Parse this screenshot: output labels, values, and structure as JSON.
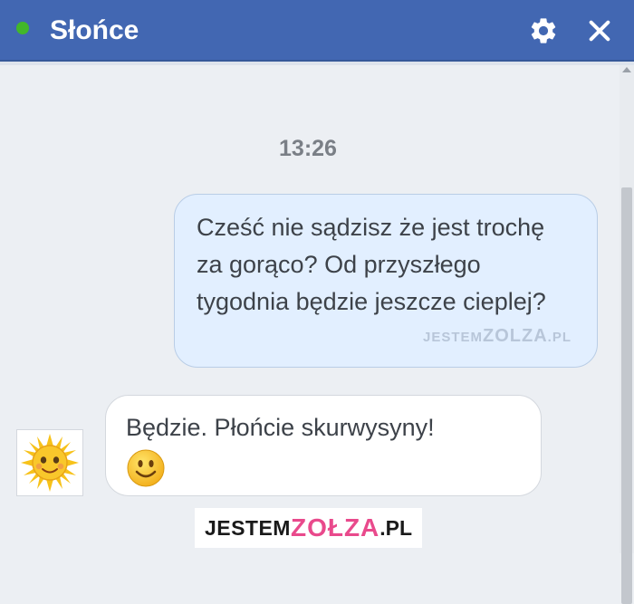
{
  "header": {
    "title": "Słońce",
    "status": "online",
    "icons": [
      "gear-icon",
      "close-icon"
    ],
    "color": "#4267b2"
  },
  "conversation": {
    "timestamp": "13:26",
    "messages": [
      {
        "direction": "outgoing",
        "text": "Cześć nie sądzisz że jest trochę za gorąco? Od przyszłego tygodnia będzie jeszcze cieplej?"
      },
      {
        "direction": "incoming",
        "text": "Będzie. Płońcie skurwysyny!",
        "emoji": "smile-emoji"
      }
    ]
  },
  "watermark": {
    "inline_prefix": "JESTEM",
    "inline_middle": "ZOLZA",
    "inline_suffix": ".PL",
    "logo_prefix": "JESTEM",
    "logo_middle": "ZOŁZA",
    "logo_suffix": ".PL"
  }
}
